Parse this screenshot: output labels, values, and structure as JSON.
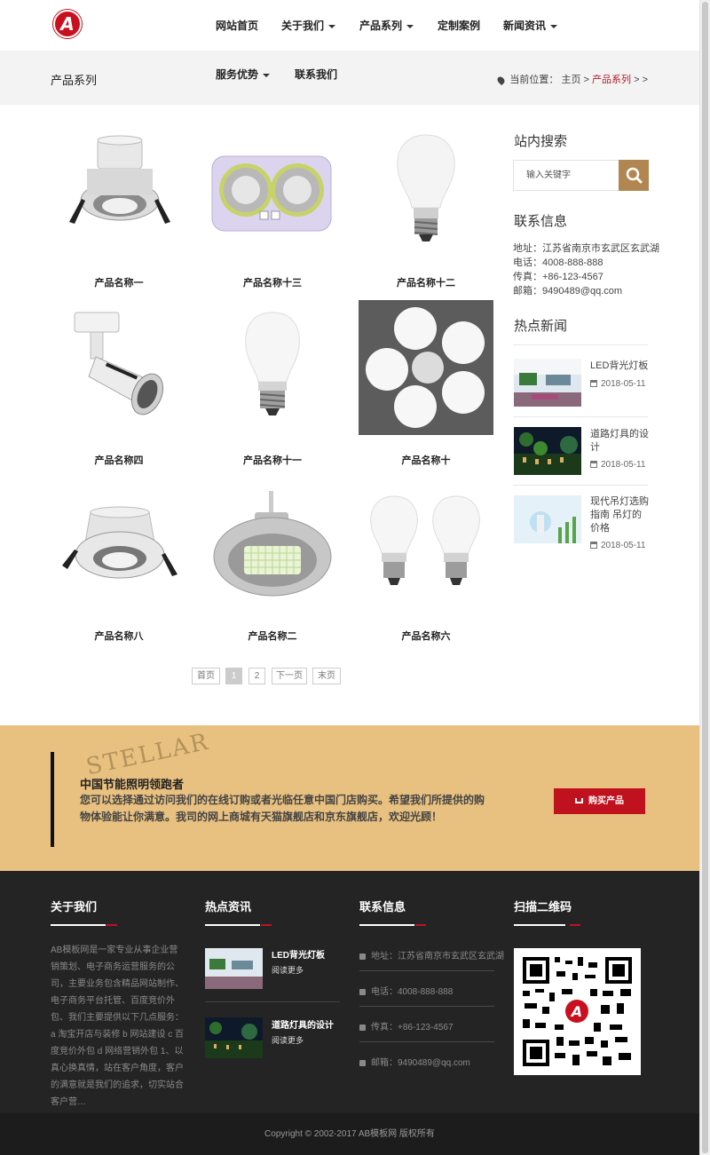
{
  "nav": {
    "items": [
      "网站首页",
      "关于我们",
      "产品系列",
      "定制案例",
      "新闻资讯",
      "服务优势",
      "联系我们"
    ]
  },
  "subbar": {
    "title": "产品系列",
    "crumb_label": "当前位置：",
    "crumb_home": "主页",
    "crumb_sep": ">",
    "crumb_current": "产品系列",
    "crumb_tail": "> >"
  },
  "products": [
    {
      "name": "产品名称一",
      "icon": "downlight"
    },
    {
      "name": "产品名称十三",
      "icon": "bath-heater"
    },
    {
      "name": "产品名称十二",
      "icon": "bulb"
    },
    {
      "name": "产品名称四",
      "icon": "spotlight"
    },
    {
      "name": "产品名称十一",
      "icon": "bulb-opple"
    },
    {
      "name": "产品名称十",
      "icon": "flower-ceiling-lamp"
    },
    {
      "name": "产品名称八",
      "icon": "downlight"
    },
    {
      "name": "产品名称二",
      "icon": "high-bay-led"
    },
    {
      "name": "产品名称六",
      "icon": "twin-bulbs"
    }
  ],
  "pager": {
    "first": "首页",
    "page1": "1",
    "page2": "2",
    "next": "下一页",
    "last": "末页"
  },
  "sidebar": {
    "search_title": "站内搜索",
    "search_placeholder": "输入关键字",
    "contact_title": "联系信息",
    "address": "地址：江苏省南京市玄武区玄武湖",
    "phone": "电话：4008-888-888",
    "fax": "传真：+86-123-4567",
    "email": "邮箱：9490489@qq.com",
    "hot_title": "热点新闻",
    "hot_news": [
      {
        "title": "LED背光灯板",
        "date": "2018-05-11"
      },
      {
        "title": "道路灯具的设计",
        "date": "2018-05-11"
      },
      {
        "title": "现代吊灯选购指南 吊灯的价格",
        "date": "2018-05-11"
      }
    ]
  },
  "promo": {
    "scribble": "STELLAR",
    "heading": "中国节能照明领跑者",
    "text": "您可以选择通过访问我们的在线订购或者光临任意中国门店购买。希望我们所提供的购物体验能让你满意。我司的网上商城有天猫旗舰店和京东旗舰店，欢迎光顾！",
    "button": "购买产品"
  },
  "footer": {
    "about_title": "关于我们",
    "about_text": "AB模板网是一家专业从事企业营销策划、电子商务运营服务的公司，主要业务包含精品网站制作、电子商务平台托管、百度竞价外包、我们主要提供以下几点服务： a 淘宝开店与装修 b 网站建设 c 百度竞价外包 d 网络营销外包 1、以真心换真情，站在客户角度，客户的满意就是我们的追求，切实站合客户营…",
    "news_title": "热点资讯",
    "news": [
      {
        "title": "LED背光灯板",
        "more": "阅读更多"
      },
      {
        "title": "道路灯具的设计",
        "more": "阅读更多"
      }
    ],
    "contact_title": "联系信息",
    "address": "地址：江苏省南京市玄武区玄武湖",
    "phone": "电话：4008-888-888",
    "fax": "传真：+86-123-4567",
    "email": "邮箱：9490489@qq.com",
    "qr_title": "扫描二维码"
  },
  "copyright": "Copyright © 2002-2017 AB模板网 版权所有",
  "colors": {
    "accent": "#c0111f",
    "gold": "#b28650",
    "promo_bg": "#e8c07f",
    "footer_bg": "#242424"
  }
}
